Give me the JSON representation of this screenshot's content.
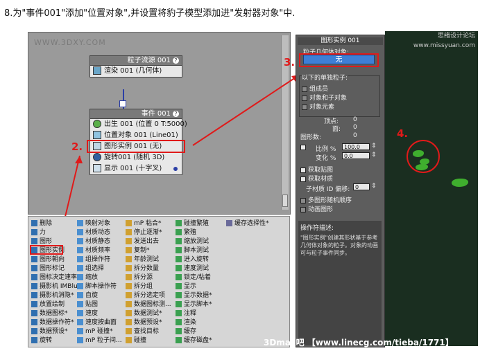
{
  "caption": "8.为\"事件001\"添加\"位置对象\",并设置将豹子模型添加进\"发射器对象\"中.",
  "particle_view": {
    "watermark": "WWW.3DXY.COM",
    "source_node": {
      "title": "粒子流源 001",
      "rows": [
        "渲染 001 (几何体)"
      ]
    },
    "event_node": {
      "title": "事件 001",
      "rows": [
        "出生 001 (位置 0 T:5000)",
        "位置对象 001 (Line01)",
        "图形实例 001 (无)",
        "旋转001 (随机 3D)",
        "显示 001 (十字叉)"
      ]
    }
  },
  "annotations": {
    "n1": "2.",
    "n2": "3.",
    "n3": "4."
  },
  "depot": {
    "col1": [
      "删除",
      "力",
      "图形",
      "图形实例",
      "图形朝向",
      "图形标记",
      "图标决定速率",
      "摄影机 IMBlur*",
      "摄影机消隐*",
      "放置绘制",
      "数据图标*",
      "数据操作符*",
      "数据预设*",
      "旋转"
    ],
    "col2": [
      "映射对象",
      "材质动态",
      "材质静态",
      "材质频率",
      "组操作符",
      "组选择",
      "缩放",
      "脚本操作符",
      "自旋",
      "贴图",
      "速度",
      "速度按曲面",
      "mP 碰撞*",
      "mP 粒子间..."
    ],
    "col3": [
      "mP 粘合*",
      "停止逐渐*",
      "发送出去",
      "复制*",
      "年龄测试",
      "拆分数量",
      "拆分源",
      "拆分组",
      "拆分选定项",
      "数据图标测...",
      "数据测试*",
      "数据预设*",
      "查找目标",
      "碰撞"
    ],
    "col4": [
      "碰撞繁殖",
      "繁殖",
      "缩放测试",
      "脚本测试",
      "进入旋转",
      "速度测试",
      "锁定/粘着",
      "显示",
      "显示数据*",
      "显示脚本*",
      "注释",
      "渲染",
      "缓存",
      "缓存磁盘*"
    ],
    "col5": [
      "缓存选择性*"
    ]
  },
  "panel": {
    "title": "图形实例 001",
    "label_particle_geom": "粒子几何体对象:",
    "none_button": "无",
    "rollout_label": "以下的单独粒子:",
    "opt_group": "组成员",
    "opt_children": "对象和子对象",
    "opt_elements": "对象元素",
    "vertices_label": "顶点:",
    "vertices_value": "0",
    "faces_label": "面:",
    "faces_value": "0",
    "shape_count_label": "图形数:",
    "shape_count_value": "0",
    "scale_label": "比例 %",
    "scale_value": "100.0",
    "variation_label": "变化 %",
    "variation_value": "0.0",
    "get_mapping": "获取贴图",
    "get_material": "获取材质",
    "sub_material_label": "子材质 ID 偏移:",
    "sub_material_value": "0",
    "multi_shape_random": "多图形随机顺序",
    "animated_shape": "动画图形",
    "desc_header": "操作符描述:",
    "desc_text": "\"图形实例\"创建其形状基于参考几何体对象的粒子。对象的动画可与粒子事件同步。"
  },
  "viewport": {
    "header": "思绪设计论坛 www.missyuan.com"
  },
  "bottom_watermark": "3Dmax吧 【www.linecg.com/tieba/1771】"
}
